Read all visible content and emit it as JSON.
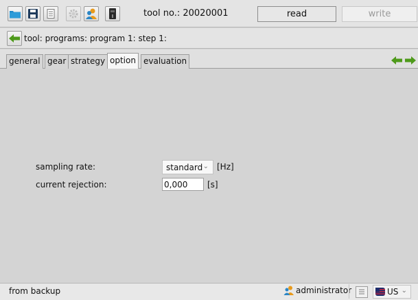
{
  "toolbar": {
    "icons": [
      "open-folder-icon",
      "save-icon",
      "print-icon",
      "gear-icon",
      "users-icon",
      "device-icon"
    ],
    "tool_no": "tool no.: 20020001",
    "read_label": "read",
    "write_label": "write"
  },
  "breadcrumb": {
    "text": "tool: programs: program 1: step 1:"
  },
  "tabs": [
    {
      "label": "general"
    },
    {
      "label": "gear"
    },
    {
      "label": "strategy"
    },
    {
      "label": "option",
      "active": true
    },
    {
      "label": "evaluation"
    }
  ],
  "form": {
    "sampling_rate_label": "sampling rate:",
    "sampling_rate_value": "standard",
    "sampling_rate_unit": "[Hz]",
    "current_rejection_label": "current rejection:",
    "current_rejection_value": "0,000",
    "current_rejection_unit": "[s]"
  },
  "status": {
    "source": "from backup",
    "user": "administrator",
    "language": "US"
  },
  "colors": {
    "background": "#d4d4d4",
    "arrow_green": "#4e9a1b",
    "folder_blue": "#1a86c8",
    "user_orange": "#e89a1c"
  }
}
